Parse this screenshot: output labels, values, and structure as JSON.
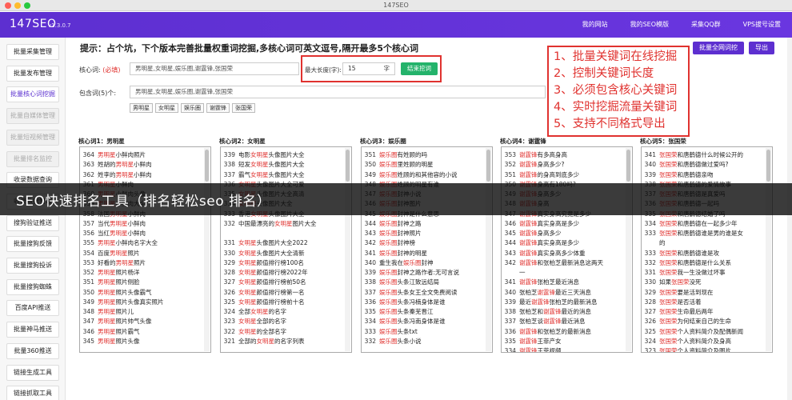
{
  "window": {
    "title": "147SEO"
  },
  "header": {
    "logo": "147SEO",
    "version": "v1.3.0.7",
    "nav": [
      "我的网站",
      "我的SEO模版",
      "采集QQ群",
      "VPS拔号设置"
    ]
  },
  "sidebar": {
    "items": [
      {
        "label": "批量采集管理",
        "state": "normal"
      },
      {
        "label": "批量发布管理",
        "state": "normal"
      },
      {
        "label": "批量核心词挖掘",
        "state": "active"
      },
      {
        "label": "批量自媒体管理",
        "state": "disabled"
      },
      {
        "label": "批量短视频管理",
        "state": "disabled"
      },
      {
        "label": "批量排名监控",
        "state": "disabled"
      },
      {
        "label": "收录数据查询",
        "state": "normal"
      },
      {
        "label": "收录数据管理",
        "state": "normal"
      },
      {
        "label": "搜狗验证推送",
        "state": "normal"
      },
      {
        "label": "批量搜狗反馈",
        "state": "normal"
      },
      {
        "label": "批量搜狗投诉",
        "state": "normal"
      },
      {
        "label": "批量搜狗蜘蛛",
        "state": "normal"
      },
      {
        "label": "百度API推送",
        "state": "normal"
      },
      {
        "label": "批量神马推送",
        "state": "normal"
      },
      {
        "label": "批量360推送",
        "state": "normal"
      },
      {
        "label": "链接生成工具",
        "state": "normal"
      },
      {
        "label": "链接抓取工具",
        "state": "normal"
      }
    ]
  },
  "main": {
    "tip": "提示：占个坑，下个版本完善批量权重词挖掘,多核心词可英文逗号,隔开最多5个核心词",
    "btn_mine": "批量全网词挖",
    "btn_export": "导出",
    "core_label": "核心词:",
    "core_required": "(必填)",
    "core_value": "男明星,女明星,娱乐圈,谢霆锋,张国荣",
    "maxlen_label": "最大长度(字):",
    "maxlen_value": "15",
    "maxlen_unit": "字",
    "btn_stop": "结束挖词",
    "include_label": "包含词(5)个:",
    "include_value": "男明星,女明星,娱乐圈,谢霆锋,张国荣",
    "tags": [
      "男明星",
      "女明星",
      "娱乐圈",
      "谢霆锋",
      "张国荣"
    ]
  },
  "callout": [
    "1、批量关键词在线挖掘",
    "2、控制关键词长度",
    "3、必须包含核心关键词",
    "4、实时挖掘流量关键词",
    "5、支持不同格式导出"
  ],
  "columns": [
    {
      "title": "核心词1：男明星",
      "keyword": "男明星",
      "lines": [
        [
          "364",
          "男明星小鲜肉照片"
        ],
        [
          "363",
          "姓胡的男明星小鲜肉"
        ],
        [
          "362",
          "姓李的男明星小鲜肉"
        ],
        [
          "361",
          "男明星小鲜肉"
        ],
        [
          "360",
          "男明星小鲜肉头像"
        ],
        [
          "359",
          "男明星小鲜肉大全"
        ],
        [
          "358",
          "法国男明星小鲜肉"
        ],
        [
          "357",
          "当代男明星小鲜肉"
        ],
        [
          "356",
          "当红男明星小鲜肉"
        ],
        [
          "355",
          "男明星小鲜肉名字大全"
        ],
        [
          "354",
          "百度男明星照片"
        ],
        [
          "353",
          "好看的男明星照片"
        ],
        [
          "352",
          "男明星照片杨洋"
        ],
        [
          "351",
          "男明星照片侧脸"
        ],
        [
          "350",
          "男明星照片头像霸气"
        ],
        [
          "349",
          "男明星照片头像真实照片"
        ],
        [
          "348",
          "男明星照片儿"
        ],
        [
          "347",
          "男明星照片帅气头像"
        ],
        [
          "346",
          "男明星照片霸气"
        ],
        [
          "345",
          "男明星照片头像"
        ]
      ]
    },
    {
      "title": "核心词2：女明星",
      "keyword": "女明星",
      "lines": [
        [
          "339",
          "电影女明星头像图片大全"
        ],
        [
          "338",
          "短发女明星头像图片大全"
        ],
        [
          "337",
          "霸气女明星头像图片大全"
        ],
        [
          "336",
          "女明星头像图片大全可爱"
        ],
        [
          "335",
          "女明星头像图片大全高清"
        ],
        [
          "334",
          "女明星头像图片大全"
        ],
        [
          "333",
          "香港女明星头像图片大全"
        ],
        [
          "332",
          "中国最漂亮的女明星图片大全"
        ],
        [
          "",
          ""
        ],
        [
          "331",
          "女明星头像图片大全2022"
        ],
        [
          "330",
          "女明星头像图片大全清新"
        ],
        [
          "329",
          "女明星颜值排行榜100名"
        ],
        [
          "328",
          "女明星颜值排行榜2022年"
        ],
        [
          "327",
          "女明星颜值排行榜前50名"
        ],
        [
          "326",
          "女明星颜值排行榜第一名"
        ],
        [
          "325",
          "女明星颜值排行榜前十名"
        ],
        [
          "324",
          "全部女明星的名字"
        ],
        [
          "323",
          "女明星全部的名字"
        ],
        [
          "322",
          "女明星的全部名字"
        ],
        [
          "321",
          "全部的女明星的名字列表"
        ]
      ]
    },
    {
      "title": "核心词3：娱乐圈",
      "keyword": "娱乐圈",
      "lines": [
        [
          "351",
          "娱乐圈有姓顾的吗"
        ],
        [
          "350",
          "娱乐圈里姓顾的明星"
        ],
        [
          "349",
          "娱乐圈姓顾的和其他容的小说"
        ],
        [
          "348",
          "娱乐圈姓顾的明星有谁"
        ],
        [
          "347",
          "娱乐圈封神小说"
        ],
        [
          "346",
          "娱乐圈封神图片"
        ],
        [
          "345",
          "娱乐圈封神是什么意思"
        ],
        [
          "344",
          "娱乐圈封神之路"
        ],
        [
          "343",
          "娱乐圈封神照片"
        ],
        [
          "342",
          "娱乐圈封神榜"
        ],
        [
          "341",
          "娱乐圈封神的明星"
        ],
        [
          "340",
          "重生我在娱乐圈封神"
        ],
        [
          "339",
          "娱乐圈封神之路作者:无可言说"
        ],
        [
          "338",
          "娱乐圈头条江致远结局"
        ],
        [
          "337",
          "娱乐圈头条女王全文免费阅读"
        ],
        [
          "336",
          "娱乐圈头条冯楠身体是谁"
        ],
        [
          "335",
          "娱乐圈头条秦芜晋江"
        ],
        [
          "334",
          "娱乐圈头条冯南身体是谁"
        ],
        [
          "333",
          "娱乐圈头条txt"
        ],
        [
          "332",
          "娱乐圈头条小说"
        ]
      ]
    },
    {
      "title": "核心词4：谢霆锋",
      "keyword": "谢霆锋",
      "lines": [
        [
          "353",
          "谢霆锋有多高身高"
        ],
        [
          "352",
          "谢霆锋身高多少?"
        ],
        [
          "351",
          "谢霆锋的身高到底多少"
        ],
        [
          "350",
          "谢霆锋身高有180吗?"
        ],
        [
          "349",
          "谢霆锋身高多少"
        ],
        [
          "348",
          "谢霆锋身高"
        ],
        [
          "347",
          "谢霆锋真实身高究竟是多少"
        ],
        [
          "346",
          "谢霆锋真实身高是多少"
        ],
        [
          "345",
          "谢霆锋身高多少"
        ],
        [
          "344",
          "谢霆锋真实身高是多少"
        ],
        [
          "343",
          "谢霆锋真实身高多少体重"
        ],
        [
          "342",
          "谢霆锋和张柏芝最新消息这两天"
        ],
        [
          "",
          "一"
        ],
        [
          "341",
          "谢霆锋张柏芝最近消息"
        ],
        [
          "340",
          "张柏芝谢霆锋最近三天消息"
        ],
        [
          "339",
          "最近谢霆锋张柏芝的最新消息"
        ],
        [
          "338",
          "张柏芝和谢霆锋最近的消息"
        ],
        [
          "337",
          "张柏芝谈谢霆锋最近消息"
        ],
        [
          "336",
          "谢霆锋和张柏芝的最新消息"
        ],
        [
          "335",
          "谢霆锋王菲产女"
        ],
        [
          "334",
          "谢霆锋王菲视频"
        ]
      ]
    },
    {
      "title": "核心词5：张国荣",
      "keyword": "张国荣",
      "lines": [
        [
          "341",
          "张国荣和唐鹤德什么时候公开的"
        ],
        [
          "340",
          "张国荣和唐鹤德做过爱吗?"
        ],
        [
          "339",
          "张国荣和唐鹤德亲吻"
        ],
        [
          "338",
          "张国荣和唐鹤德的爱情故事"
        ],
        [
          "337",
          "张国荣和唐鹤德是真爱吗"
        ],
        [
          "336",
          "张国荣和唐鹤德一起吗"
        ],
        [
          "335",
          "张国荣和唐鹤德结婚了吗"
        ],
        [
          "334",
          "张国荣和唐鹤德在一起多少年"
        ],
        [
          "333",
          "张国荣和唐鹤德谁是男的谁是女"
        ],
        [
          "",
          "的"
        ],
        [
          "333",
          "张国荣和唐鹤德谁是攻"
        ],
        [
          "332",
          "张国荣和唐鹤德是什么关系"
        ],
        [
          "331",
          "张国荣我一生没做过坏事"
        ],
        [
          "330",
          "如果张国荣没死"
        ],
        [
          "329",
          "张国荣要是活到现在"
        ],
        [
          "328",
          "张国荣是否活着"
        ],
        [
          "327",
          "张国荣生命最后两年"
        ],
        [
          "326",
          "张国荣为何结束自己的生命"
        ],
        [
          "325",
          "张国荣个人资料简介及配偶新闻"
        ],
        [
          "324",
          "张国荣个人资料简介及身高"
        ],
        [
          "323",
          "张国荣个人资料简介及图片"
        ]
      ]
    }
  ],
  "banner": {
    "text": "SEO快速排名工具（排名轻松seo 排名）"
  }
}
